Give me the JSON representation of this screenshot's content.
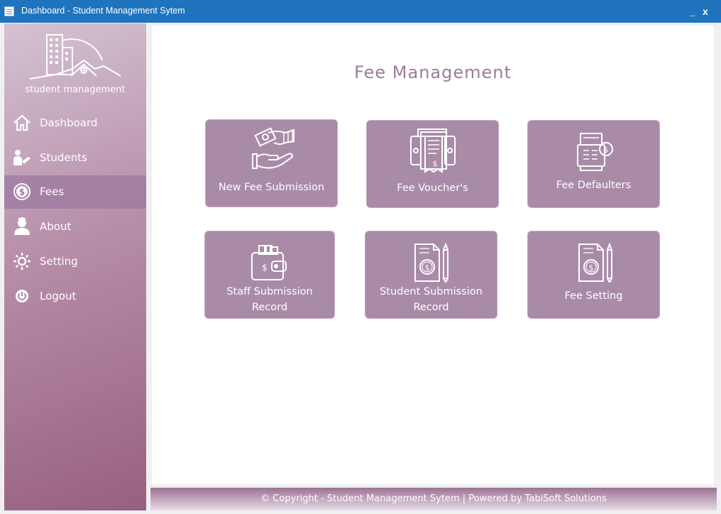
{
  "window": {
    "title": "Dashboard - Student Management Sytem",
    "minimize_label": "_",
    "close_label": "x"
  },
  "sidebar": {
    "logo_text": "student management",
    "items": [
      {
        "label": "Dashboard",
        "icon": "home-icon"
      },
      {
        "label": "Students",
        "icon": "students-icon"
      },
      {
        "label": "Fees",
        "icon": "dollar-coin-icon",
        "active": true
      },
      {
        "label": "About",
        "icon": "person-icon"
      },
      {
        "label": "Setting",
        "icon": "gear-icon"
      },
      {
        "label": "Logout",
        "icon": "power-icon"
      }
    ]
  },
  "main": {
    "title": "Fee Management",
    "tiles": [
      {
        "label": "New Fee Submission",
        "icon": "hand-money-icon"
      },
      {
        "label": "Fee Voucher's",
        "icon": "receipt-icon"
      },
      {
        "label": "Fee Defaulters",
        "icon": "cash-register-icon"
      },
      {
        "label_line1": "Staff Submission",
        "label_line2": "Record",
        "icon": "wallet-icon"
      },
      {
        "label_line1": "Student Submission",
        "label_line2": "Record",
        "icon": "document-dollar-icon"
      },
      {
        "label": "Fee Setting",
        "icon": "document-dollar-pencil-icon"
      }
    ]
  },
  "footer": {
    "text": "© Copyright - Student Management Sytem | Powered by TabiSoft Solutions"
  },
  "colors": {
    "titlebar": "#1f74bd",
    "tile": "#a98ba8",
    "title_text": "#9c7c9c"
  }
}
